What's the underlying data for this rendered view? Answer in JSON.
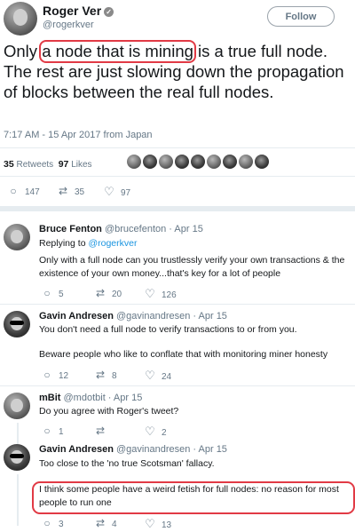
{
  "tweet": {
    "author_name": "Roger Ver",
    "author_handle": "@rogerkver",
    "follow_label": "Follow",
    "text_before": "Only ",
    "text_highlight": "a node that is mining",
    "text_after": " is a true full node. The rest are just slowing down the propagation of blocks between the real full nodes.",
    "timestamp": "7:17 AM - 15 Apr 2017 from Japan",
    "retweets_count": "35",
    "retweets_label": "Retweets",
    "likes_count": "97",
    "likes_label": "Likes",
    "actions": {
      "replies": "147",
      "retweets": "35",
      "likes": "97"
    }
  },
  "replies": [
    {
      "name": "Bruce Fenton",
      "meta": "@brucefenton · Apr 15",
      "replying_prefix": "Replying to ",
      "replying_handle": "@rogerkver",
      "text": "Only with a full node can you trustlessly verify your own transactions & the existence of your own money...that's key for a lot of people",
      "actions": {
        "replies": "5",
        "retweets": "20",
        "likes": "126"
      }
    },
    {
      "name": "Gavin Andresen",
      "meta": "@gavinandresen · Apr 15",
      "text": "You don't need a full node to verify transactions to or from you.",
      "text2": "Beware people who like to conflate that with monitoring miner honesty",
      "actions": {
        "replies": "12",
        "retweets": "8",
        "likes": "24"
      }
    },
    {
      "name": "mBit",
      "meta": "@mdotbit · Apr 15",
      "text": "Do you agree with Roger's tweet?",
      "actions": {
        "replies": "1",
        "retweets": "",
        "likes": "2"
      }
    },
    {
      "name": "Gavin Andresen",
      "meta": "@gavinandresen · Apr 15",
      "text": "Too close to the 'no true Scotsman' fallacy.",
      "text2": "I think some people have a weird fetish for full nodes: no reason for most people to run one",
      "actions": {
        "replies": "3",
        "retweets": "4",
        "likes": "13"
      }
    }
  ],
  "icons": {
    "reply": "reply-icon",
    "retweet": "retweet-icon",
    "like": "heart-icon",
    "verified": "verified-badge-icon"
  },
  "colors": {
    "highlight": "#e13a45",
    "link": "#1b95e0",
    "muted": "#657786"
  }
}
